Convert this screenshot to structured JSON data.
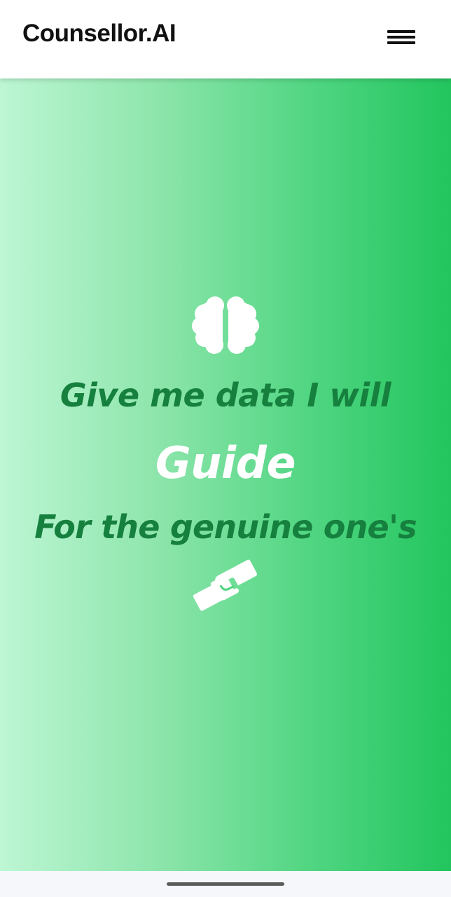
{
  "header": {
    "brand": "Counsellor.AI",
    "menu_icon": "hamburger-menu-icon"
  },
  "hero": {
    "icon_top": "brain-icon",
    "line1": "Give me data I will",
    "line2": "Guide",
    "line3": "For the genuine one's",
    "icon_bottom": "handshake-icon"
  },
  "colors": {
    "gradient_start": "#bdf6d4",
    "gradient_end": "#22c55e",
    "accent_text": "#16803e",
    "highlight_text": "#ffffff",
    "header_bg": "#ffffff"
  }
}
